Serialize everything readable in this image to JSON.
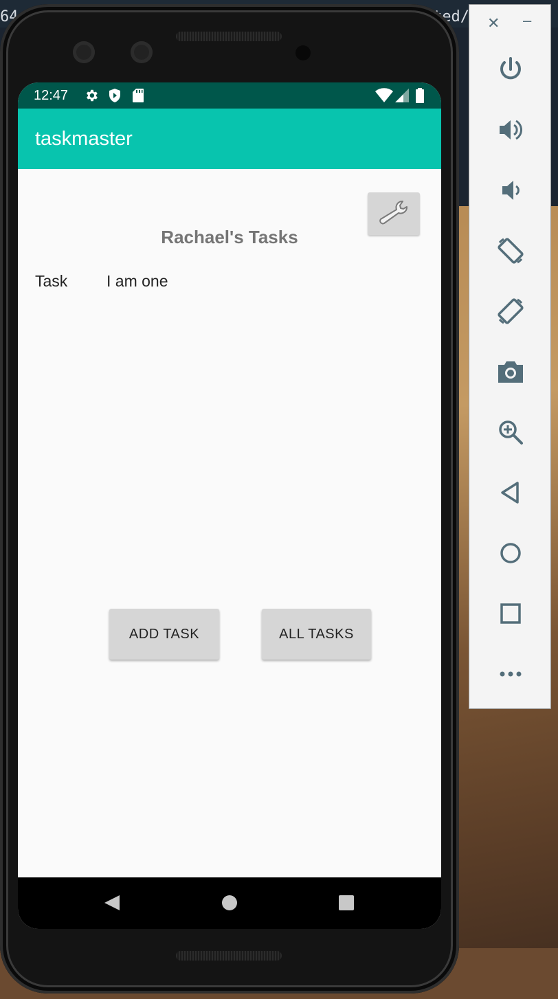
{
  "status_bar": {
    "time": "12:47"
  },
  "app": {
    "title": "taskmaster"
  },
  "main": {
    "heading": "Rachael's Tasks",
    "task": {
      "label": "Task",
      "value": "I am one"
    },
    "add_task_label": "ADD TASK",
    "all_tasks_label": "ALL TASKS"
  },
  "desktop": {
    "text_left": "64",
    "text_right": "ted/"
  },
  "colors": {
    "appbar": "#08c4ae",
    "statusbar": "#00574b",
    "button": "#d6d6d6",
    "heading": "#757575"
  },
  "emulator_toolbar": {
    "icons": [
      "close-icon",
      "minimize-icon",
      "power-icon",
      "volume-up-icon",
      "volume-down-icon",
      "rotate-left-icon",
      "rotate-right-icon",
      "camera-icon",
      "zoom-icon",
      "back-icon",
      "home-icon",
      "overview-icon",
      "more-icon"
    ]
  }
}
